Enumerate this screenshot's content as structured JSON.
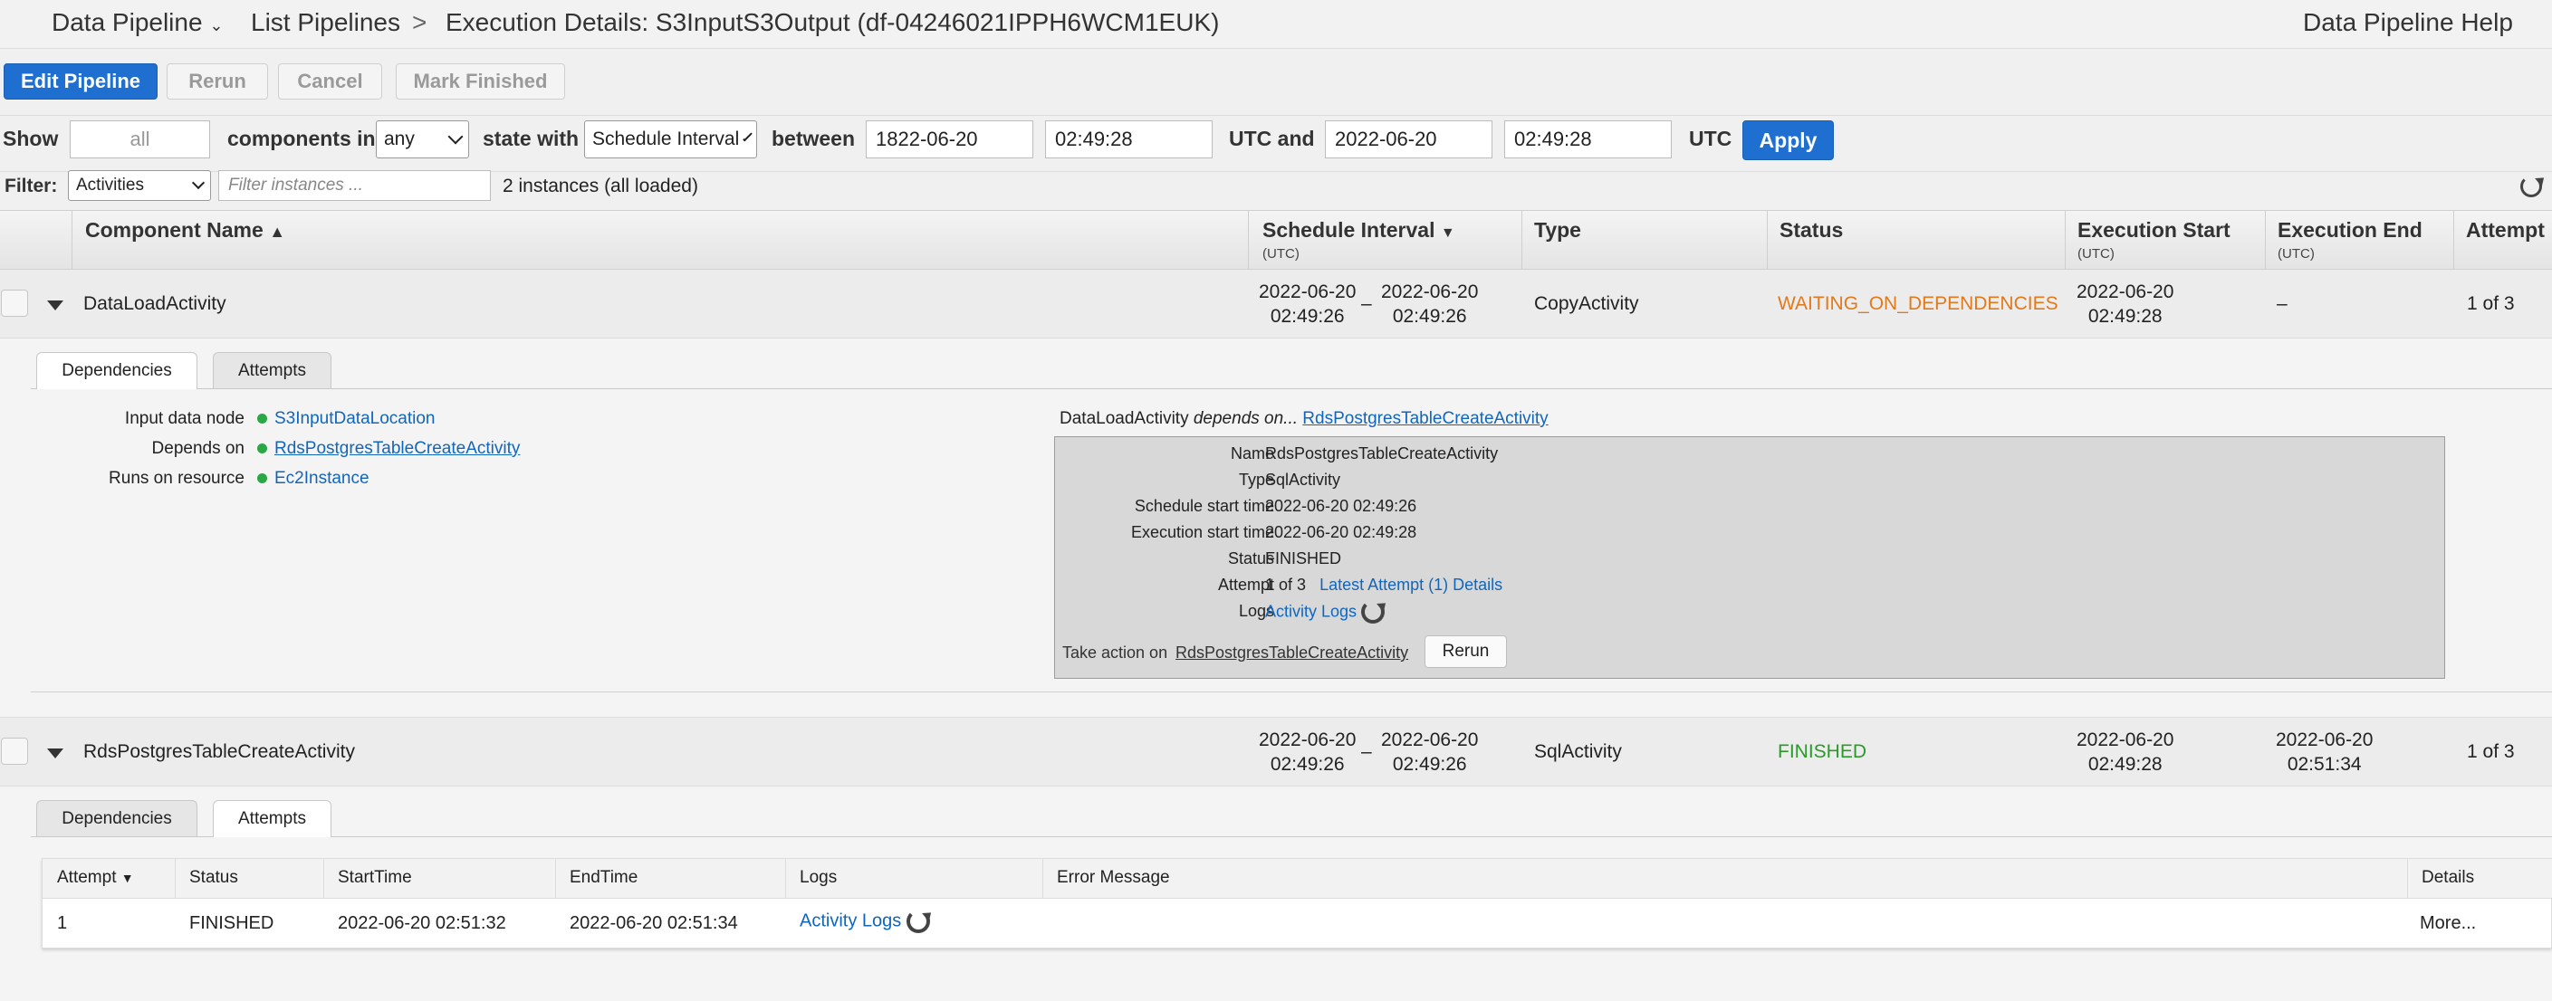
{
  "header": {
    "service": "Data Pipeline",
    "breadcrumb_link": "List Pipelines",
    "separator": ">",
    "page_title": "Execution Details: S3InputS3Output (df-04246021IPPH6WCM1EUK)",
    "help": "Data Pipeline Help"
  },
  "toolbar": {
    "edit": "Edit Pipeline",
    "rerun": "Rerun",
    "cancel": "Cancel",
    "mark_finished": "Mark Finished"
  },
  "filters": {
    "show": "Show",
    "show_placeholder": "all",
    "components_in": "components in",
    "components_value": "any",
    "state_with": "state with",
    "state_value": "Schedule Interval",
    "between": "between",
    "start_date": "1822-06-20",
    "start_time": "02:49:28",
    "utc_and": "UTC and",
    "end_date": "2022-06-20",
    "end_time": "02:49:28",
    "utc": "UTC",
    "apply": "Apply",
    "filter_label": "Filter:",
    "filter_type": "Activities",
    "filter_placeholder": "Filter instances ...",
    "instances_count": "2 instances (all loaded)"
  },
  "columns": {
    "component_name": "Component Name",
    "schedule_interval": "Schedule Interval",
    "utc": "(UTC)",
    "type": "Type",
    "status": "Status",
    "execution_start": "Execution Start",
    "execution_end": "Execution End",
    "attempt": "Attempt"
  },
  "rows": [
    {
      "name": "DataLoadActivity",
      "sched_start_date": "2022-06-20",
      "sched_start_time": "02:49:26",
      "dash": "–",
      "sched_end_date": "2022-06-20",
      "sched_end_time": "02:49:26",
      "type": "CopyActivity",
      "status": "WAITING_ON_DEPENDENCIES",
      "exec_start_date": "2022-06-20",
      "exec_start_time": "02:49:28",
      "exec_end": "–",
      "attempt": "1 of 3"
    },
    {
      "name": "RdsPostgresTableCreateActivity",
      "sched_start_date": "2022-06-20",
      "sched_start_time": "02:49:26",
      "dash": "–",
      "sched_end_date": "2022-06-20",
      "sched_end_time": "02:49:26",
      "type": "SqlActivity",
      "status": "FINISHED",
      "exec_start_date": "2022-06-20",
      "exec_start_time": "02:49:28",
      "exec_end_date": "2022-06-20",
      "exec_end_time": "02:51:34",
      "attempt": "1 of 3"
    }
  ],
  "tabs": {
    "dependencies": "Dependencies",
    "attempts": "Attempts"
  },
  "details1": {
    "input_label": "Input data node",
    "input_value": "S3InputDataLocation",
    "depends_label": "Depends on",
    "depends_value": "RdsPostgresTableCreateActivity",
    "runs_label": "Runs on resource",
    "runs_value": "Ec2Instance",
    "dep_prefix": "DataLoadActivity",
    "dep_italic": "depends on...",
    "dep_link": "RdsPostgresTableCreateActivity",
    "box": {
      "name_k": "Name",
      "name_v": "RdsPostgresTableCreateActivity",
      "type_k": "Type",
      "type_v": "SqlActivity",
      "sched_k": "Schedule start time",
      "sched_v": "2022-06-20 02:49:26",
      "exec_k": "Execution start time",
      "exec_v": "2022-06-20 02:49:28",
      "status_k": "Status",
      "status_v": "FINISHED",
      "attempt_k": "Attempt",
      "attempt_v": "1 of 3",
      "attempt_link": "Latest Attempt (1) Details",
      "logs_k": "Logs",
      "logs_link": "Activity Logs",
      "take_action": "Take action on",
      "take_action_link": "RdsPostgresTableCreateActivity",
      "rerun": "Rerun"
    }
  },
  "attempts": {
    "headers": [
      "Attempt",
      "Status",
      "StartTime",
      "EndTime",
      "Logs",
      "Error Message",
      "Details"
    ],
    "row": {
      "attempt": "1",
      "status": "FINISHED",
      "start": "2022-06-20 02:51:32",
      "end": "2022-06-20 02:51:34",
      "logs": "Activity Logs",
      "error": "",
      "details": "More..."
    }
  },
  "colors": {
    "primary": "#1f6fd1",
    "link": "#1166bb",
    "status_waiting": "#e2791a",
    "status_finished": "#2a9a2a"
  }
}
